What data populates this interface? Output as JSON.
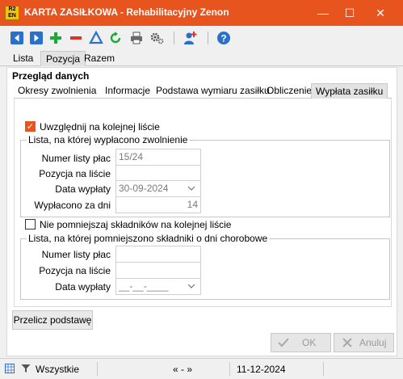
{
  "window": {
    "app_icon_text": "R2\nEN",
    "title": "KARTA ZASIŁKOWA - Rehabilitacyjny Zenon",
    "minimize": "—",
    "maximize": "☐",
    "close": "✕"
  },
  "main_tabs": [
    {
      "label": "Lista",
      "active": false
    },
    {
      "label": "Pozycja",
      "active": true
    },
    {
      "label": "Razem",
      "active": false
    }
  ],
  "section_title": "Przegląd danych",
  "sub_tabs": [
    {
      "label": "Okresy zwolnienia",
      "active": false
    },
    {
      "label": "Informacje",
      "active": false
    },
    {
      "label": "Podstawa wymiaru zasiłku",
      "active": false
    },
    {
      "label": "Obliczenie",
      "active": false
    },
    {
      "label": "Wypłata zasiłku",
      "active": true
    }
  ],
  "include_next_list": {
    "label": "Uwzględnij na kolejnej liście",
    "checked": true
  },
  "paid_group": {
    "legend": "Lista, na której wypłacono zwolnienie",
    "payroll_number_label": "Numer listy płac",
    "payroll_number_value": "15/24",
    "position_label": "Pozycja na liście",
    "position_value": "",
    "pay_date_label": "Data wypłaty",
    "pay_date_value": "30-09-2024",
    "paid_days_label": "Wypłacono za dni",
    "paid_days_value": "14"
  },
  "no_reduce": {
    "label": "Nie pomniejszaj składników na kolejnej liście",
    "checked": false
  },
  "reduced_group": {
    "legend": "Lista, na której pomniejszono składniki o dni chorobowe",
    "payroll_number_label": "Numer listy płac",
    "payroll_number_value": "",
    "position_label": "Pozycja na liście",
    "position_value": "",
    "pay_date_label": "Data wypłaty",
    "pay_date_value": "__-__-____"
  },
  "buttons": {
    "recalculate": "Przelicz podstawę",
    "ok": "OK",
    "cancel": "Anuluj"
  },
  "statusbar": {
    "filter_text": "Wszystkie",
    "nav_text": "« - »",
    "date": "11-12-2024"
  },
  "colors": {
    "titlebar": "#e8541e",
    "accent_check": "#e8541e",
    "nav_blue": "#2a6fc9",
    "add_green": "#1fa83a",
    "remove_red": "#d9342b"
  }
}
